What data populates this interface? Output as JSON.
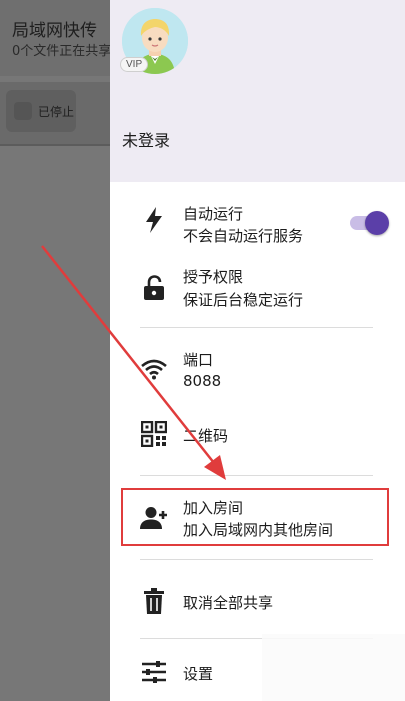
{
  "background_app": {
    "title": "局域网快传",
    "subtitle": "0个文件正在共享",
    "chip_label": "已停止"
  },
  "drawer": {
    "avatar_badge": "VIP",
    "login_status": "未登录",
    "items": [
      {
        "name": "auto-run",
        "icon": "bolt-icon",
        "title": "自动运行",
        "subtitle": "不会自动运行服务",
        "toggle_on": true
      },
      {
        "name": "grant-permission",
        "icon": "unlock-icon",
        "title": "授予权限",
        "subtitle": "保证后台稳定运行"
      },
      {
        "name": "port",
        "icon": "wifi-icon",
        "title": "端口",
        "subtitle": "8088"
      },
      {
        "name": "qrcode",
        "icon": "qrcode-icon",
        "title": "二维码"
      },
      {
        "name": "join-room",
        "icon": "person-add-icon",
        "title": "加入房间",
        "subtitle": "加入局域网内其他房间"
      },
      {
        "name": "cancel-share",
        "icon": "trash-icon",
        "title": "取消全部共享"
      },
      {
        "name": "settings",
        "icon": "sliders-icon",
        "title": "设置"
      }
    ]
  },
  "colors": {
    "accent": "#5b3fa8",
    "annotation": "#e03c3c",
    "drawer_header": "#eeebf3"
  }
}
